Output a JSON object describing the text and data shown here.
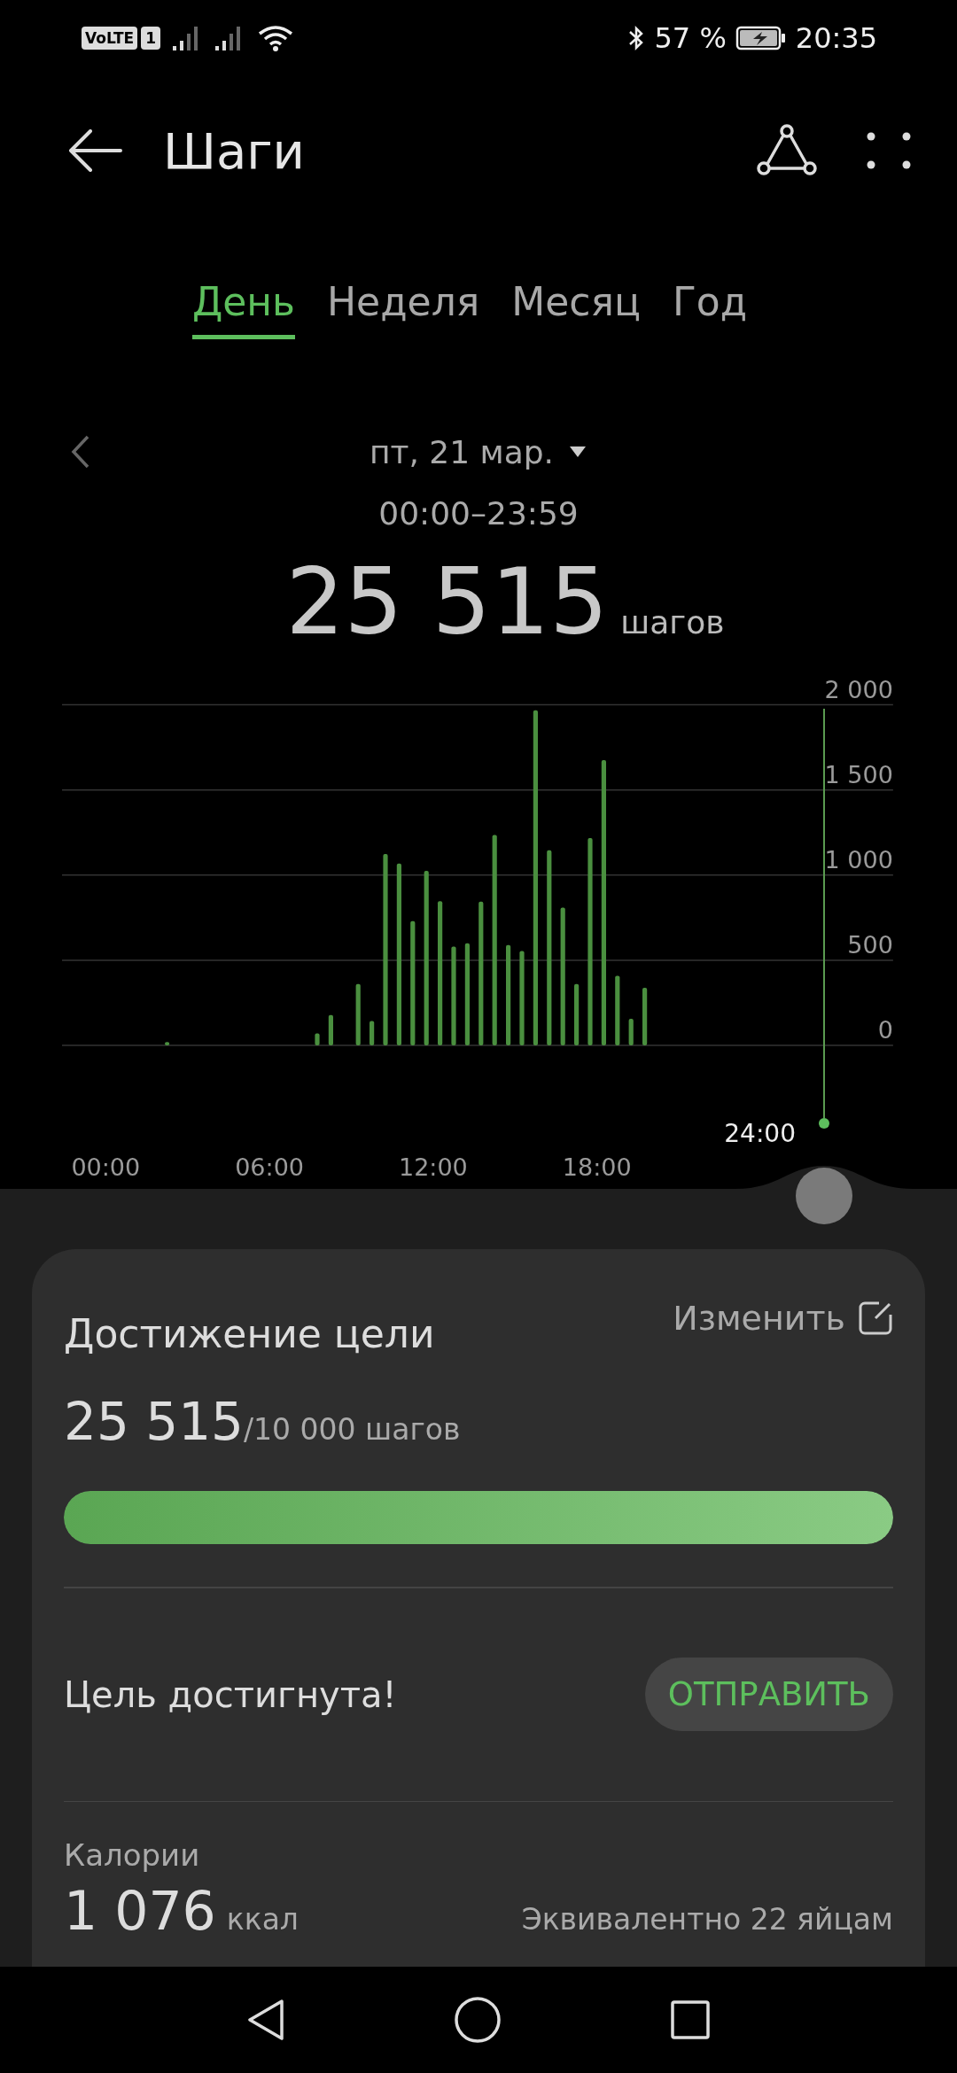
{
  "status_bar": {
    "volte": "VoLTE",
    "sim": "1",
    "battery": "57 %",
    "time": "20:35"
  },
  "header": {
    "title": "Шаги"
  },
  "tabs": [
    {
      "label": "День",
      "selected": true
    },
    {
      "label": "Неделя",
      "selected": false
    },
    {
      "label": "Месяц",
      "selected": false
    },
    {
      "label": "Год",
      "selected": false
    }
  ],
  "date": {
    "label": "пт, 21 мар.",
    "range": "00:00–23:59"
  },
  "total": {
    "value": "25 515",
    "unit": "шагов"
  },
  "chart_data": {
    "type": "bar",
    "grid": true,
    "x": [
      2.25,
      7.75,
      8.25,
      9.25,
      9.75,
      10.25,
      10.75,
      11.25,
      11.75,
      12.25,
      12.75,
      13.25,
      13.75,
      14.25,
      14.75,
      15.25,
      15.75,
      16.25,
      16.75,
      17.25,
      17.75,
      18.25,
      18.75,
      19.25,
      19.75
    ],
    "values": [
      20,
      70,
      178,
      360,
      143,
      1124,
      1067,
      729,
      1025,
      847,
      580,
      599,
      844,
      1236,
      589,
      554,
      1968,
      1146,
      809,
      360,
      1217,
      1675,
      408,
      156,
      338
    ],
    "xlim": [
      -1.6,
      28.85
    ],
    "ylim": [
      0,
      2000
    ],
    "yticks": [
      {
        "value": 2000,
        "label": "2 000"
      },
      {
        "value": 1500,
        "label": "1 500"
      },
      {
        "value": 1000,
        "label": "1 000"
      },
      {
        "value": 500,
        "label": "500"
      },
      {
        "value": 0,
        "label": "0"
      }
    ],
    "xticks": [
      {
        "value": 0,
        "label": "00:00"
      },
      {
        "value": 6,
        "label": "06:00"
      },
      {
        "value": 12,
        "label": "12:00"
      },
      {
        "value": 18,
        "label": "18:00"
      }
    ]
  },
  "scrubber": {
    "label": "24:00"
  },
  "goal": {
    "title": "Достижение цели",
    "edit": "Изменить",
    "value": "25 515",
    "target": "/10 000 шагов",
    "level": 1,
    "status": "Цель достигнута!",
    "button": "ОТПРАВИТЬ"
  },
  "calories": {
    "label": "Калории",
    "value": "1 076",
    "unit": "ккал",
    "equivalent": "Эквивалентно 22 яйцам"
  }
}
